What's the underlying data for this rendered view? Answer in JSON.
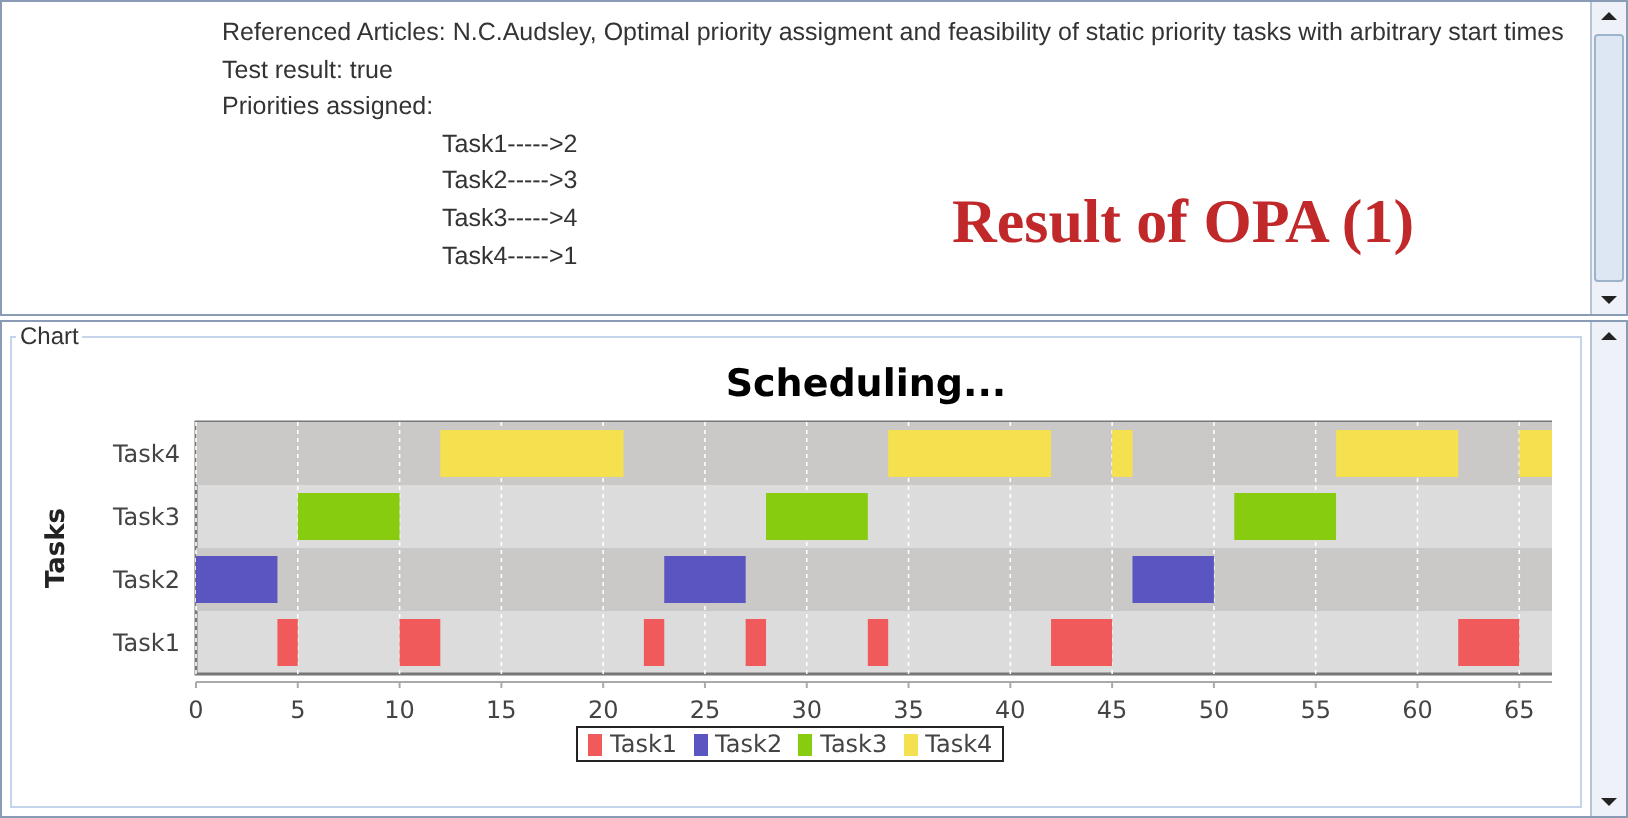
{
  "report": {
    "article": "Referenced Articles: N.C.Audsley, Optimal priority assigment and feasibility of static priority tasks with arbitrary start times",
    "test_result": "Test result: true",
    "priorities_label": "Priorities assigned:",
    "priorities": [
      "Task1----->2",
      "Task2----->3",
      "Task3----->4",
      "Task4----->1"
    ],
    "caption": "Result of OPA (1)"
  },
  "chart_panel": {
    "label": "Chart",
    "title": "Scheduling...",
    "ylabel": "Tasks",
    "rows": [
      "Task4",
      "Task3",
      "Task2",
      "Task1"
    ],
    "xticks": [
      "0",
      "5",
      "10",
      "15",
      "20",
      "25",
      "30",
      "35",
      "40",
      "45",
      "50",
      "55",
      "60",
      "65"
    ],
    "legend": [
      {
        "label": "Task1",
        "color": "#f05a5a"
      },
      {
        "label": "Task2",
        "color": "#5a55c0"
      },
      {
        "label": "Task3",
        "color": "#88cc10"
      },
      {
        "label": "Task4",
        "color": "#f5e050"
      }
    ]
  }
}
